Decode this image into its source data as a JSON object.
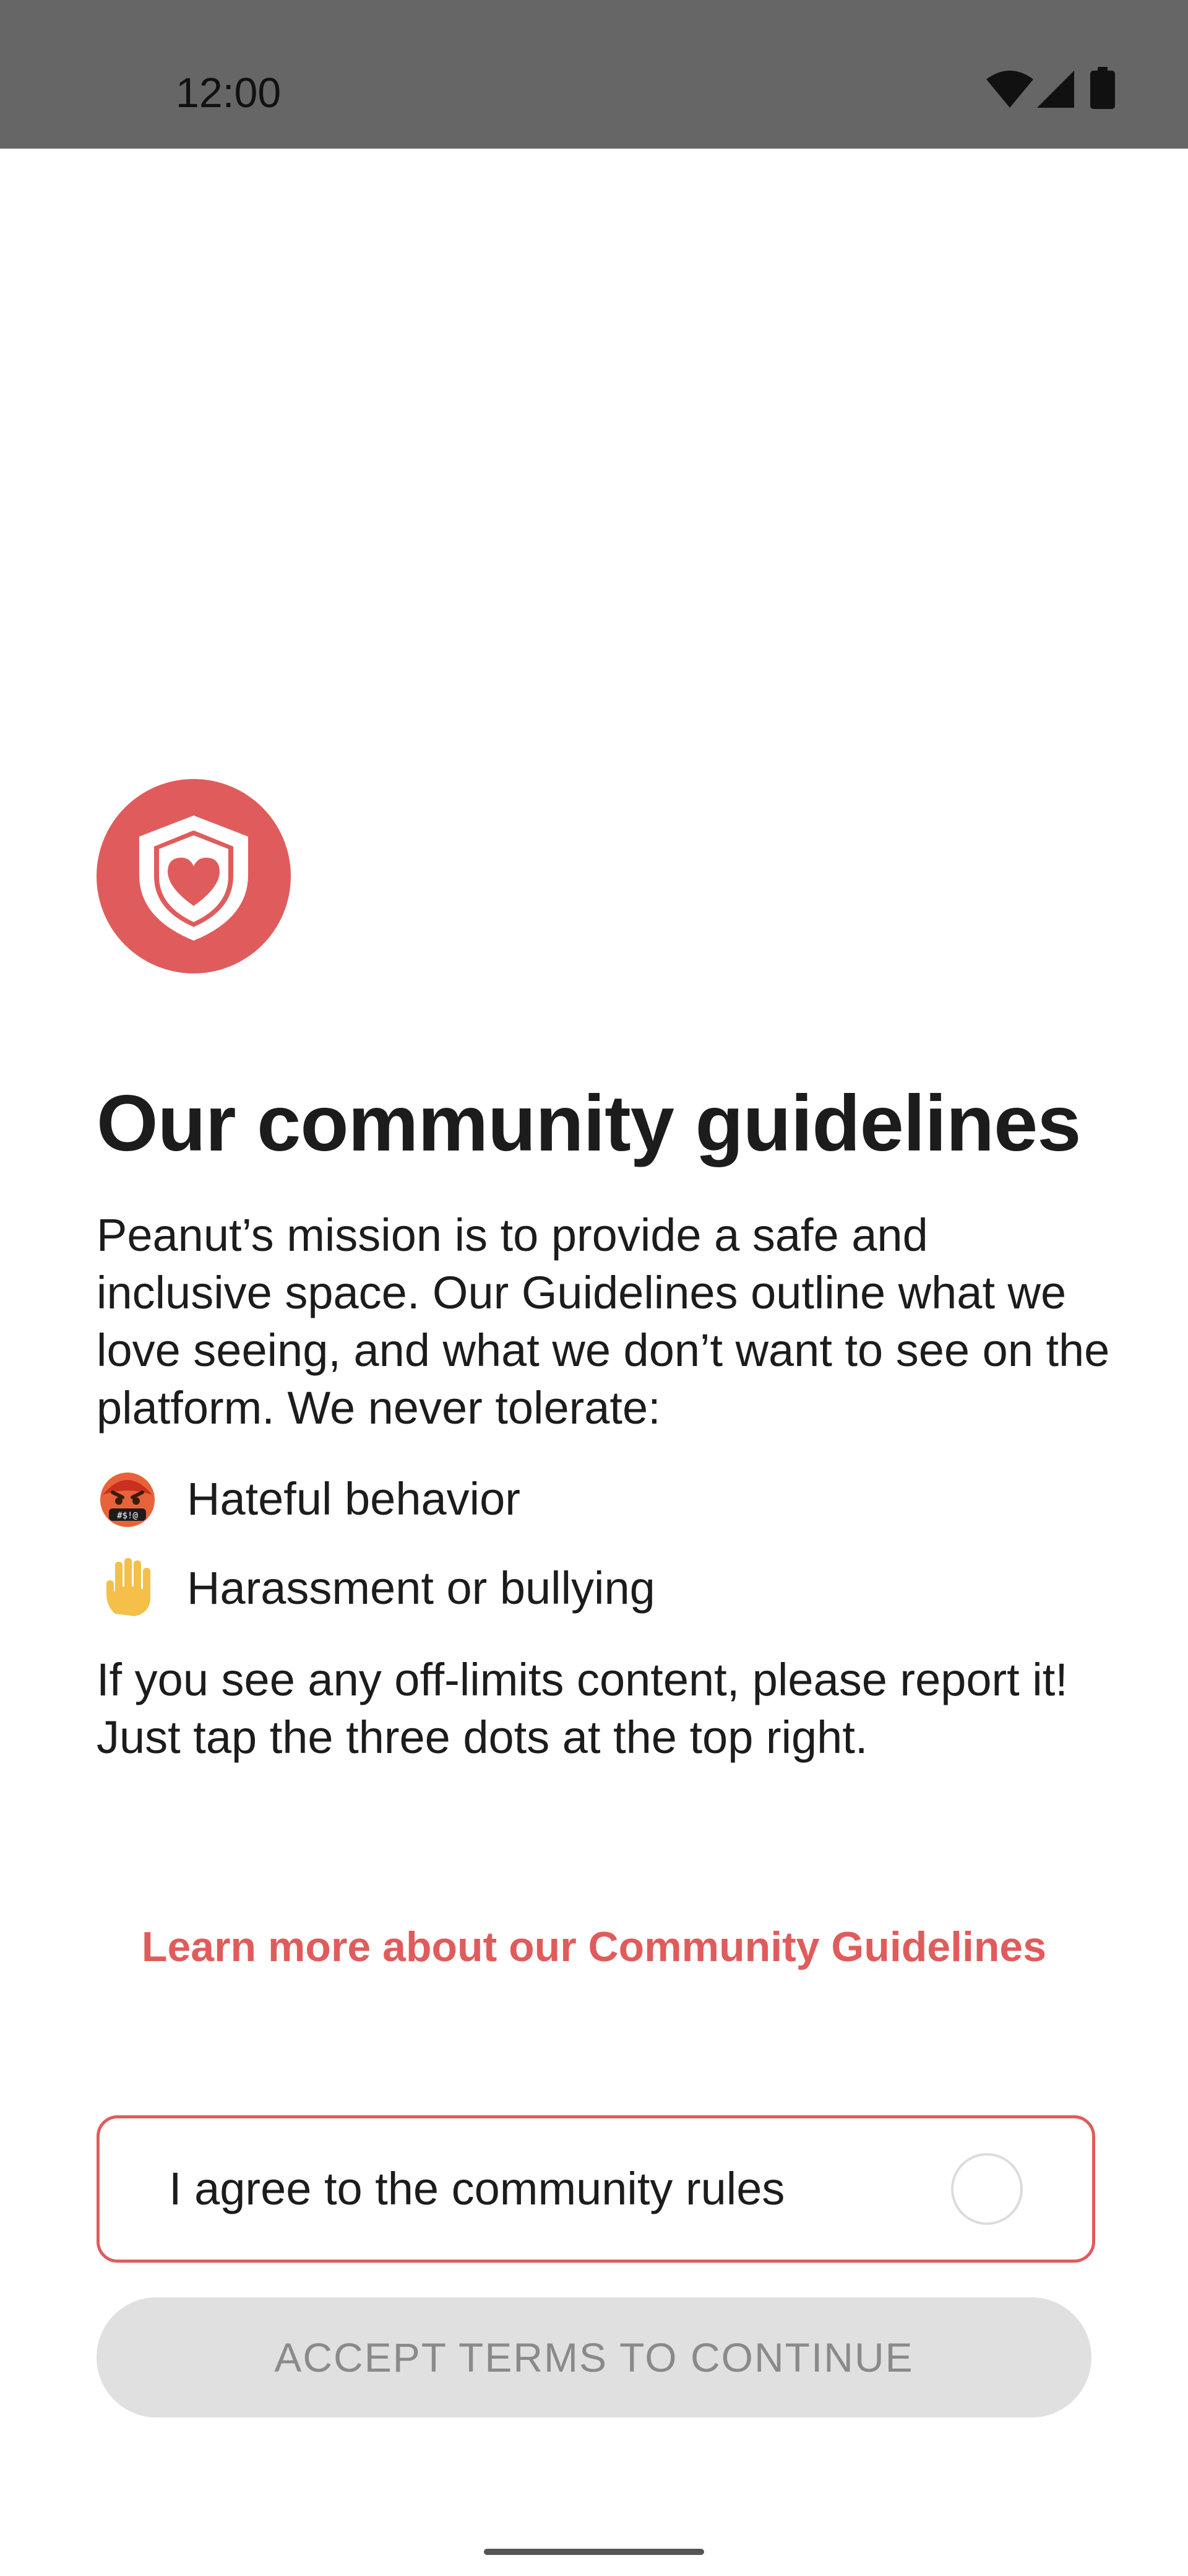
{
  "status_bar": {
    "time": "12:00",
    "icons": [
      "wifi-icon",
      "cellular-signal-icon",
      "battery-icon"
    ]
  },
  "header": {
    "badge_icon": "shield-heart-icon",
    "title": "Our community guidelines"
  },
  "body": {
    "intro": "Peanut’s mission is to provide a safe and inclusive space. Our Guidelines outline what we love seeing, and what we don’t want to see on the platform. We never tolerate:",
    "rules": [
      {
        "icon": "cursing-face-emoji",
        "label": "Hateful behavior"
      },
      {
        "icon": "raised-hand-emoji",
        "label": "Harassment or bullying"
      }
    ],
    "outro": "If you see any off-limits content, please report it! Just tap the three dots at the top right."
  },
  "link": {
    "label": "Learn more about our Community Guidelines"
  },
  "agreement": {
    "label": "I agree to the community rules",
    "checked": false
  },
  "accept_button": {
    "label": "ACCEPT TERMS TO CONTINUE",
    "enabled": false
  },
  "colors": {
    "accent": "#e05c5c",
    "status_bar": "#666666",
    "button_disabled_bg": "#e0e0e0",
    "button_disabled_text": "#8a8a8a"
  }
}
